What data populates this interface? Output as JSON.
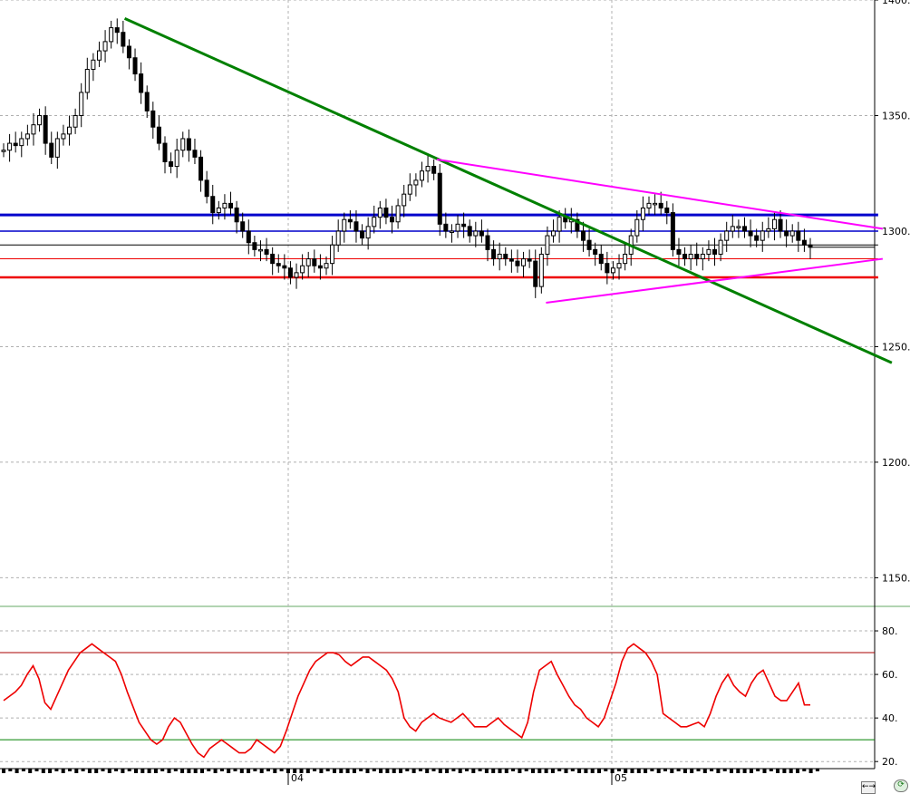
{
  "chart_data": [
    {
      "type": "candlestick",
      "panel": "price",
      "x_labels": [
        "04",
        "05"
      ],
      "y_ticks": [
        1150,
        1200,
        1250,
        1300,
        1350,
        1400
      ],
      "y_tick_labels": [
        "1150.",
        "1200.",
        "1250.",
        "1300.",
        "1350.",
        "1400."
      ],
      "ylim": [
        1138,
        1400
      ],
      "grid": true,
      "grid_style": "dashed",
      "colors": {
        "price": "#000000",
        "trend_down": "#008000",
        "triangle": "#ff00ff",
        "resistance": "#0000cc",
        "support": "#ee0000"
      },
      "close_series": [
        1335,
        1338,
        1337,
        1340,
        1342,
        1346,
        1350,
        1338,
        1332,
        1340,
        1342,
        1345,
        1350,
        1360,
        1370,
        1374,
        1378,
        1382,
        1388,
        1386,
        1380,
        1375,
        1368,
        1360,
        1352,
        1345,
        1338,
        1330,
        1328,
        1335,
        1340,
        1335,
        1332,
        1322,
        1315,
        1308,
        1310,
        1312,
        1310,
        1304,
        1300,
        1295,
        1292,
        1292,
        1290,
        1286,
        1285,
        1284,
        1280,
        1282,
        1285,
        1288,
        1285,
        1284,
        1286,
        1294,
        1300,
        1305,
        1304,
        1300,
        1297,
        1302,
        1306,
        1310,
        1306,
        1304,
        1311,
        1316,
        1320,
        1322,
        1326,
        1328,
        1325,
        1303,
        1300,
        1300,
        1303,
        1302,
        1298,
        1300,
        1298,
        1292,
        1288,
        1290,
        1288,
        1287,
        1285,
        1288,
        1287,
        1276,
        1290,
        1298,
        1300,
        1306,
        1304,
        1305,
        1300,
        1296,
        1292,
        1290,
        1286,
        1282,
        1284,
        1286,
        1290,
        1298,
        1305,
        1310,
        1312,
        1312,
        1310,
        1308,
        1292,
        1290,
        1288,
        1290,
        1288,
        1290,
        1292,
        1290,
        1296,
        1300,
        1302,
        1302,
        1300,
        1298,
        1296,
        1300,
        1301,
        1305,
        1300,
        1298,
        1300,
        1296,
        1294,
        1293
      ],
      "lines": [
        {
          "style": "trend",
          "from": [
            0.137,
            1392
          ],
          "to": [
            0.98,
            1243
          ]
        },
        {
          "style": "triangle_upper",
          "from": [
            0.48,
            1331
          ],
          "to": [
            0.97,
            1301
          ]
        },
        {
          "style": "triangle_lower",
          "from": [
            0.6,
            1269
          ],
          "to": [
            0.97,
            1288
          ]
        },
        {
          "style": "resistance_thick",
          "from": [
            0.0,
            1307
          ],
          "to": [
            0.965,
            1307
          ]
        },
        {
          "style": "resistance_thin",
          "from": [
            0.0,
            1300
          ],
          "to": [
            0.965,
            1300
          ]
        },
        {
          "style": "black_thin",
          "from": [
            0.0,
            1294
          ],
          "to": [
            0.965,
            1294
          ]
        },
        {
          "style": "red_thin",
          "from": [
            0.0,
            1288
          ],
          "to": [
            0.965,
            1288
          ]
        },
        {
          "style": "support_thick",
          "from": [
            0.0,
            1280
          ],
          "to": [
            0.965,
            1280
          ]
        }
      ]
    },
    {
      "type": "line",
      "panel": "oscillator",
      "y_ticks": [
        20,
        40,
        60,
        80
      ],
      "y_tick_labels": [
        "20.",
        "40.",
        "60.",
        "80."
      ],
      "ylim": [
        18,
        90
      ],
      "reference_lines": [
        70,
        30
      ],
      "colors": {
        "line": "#ee0000",
        "upper": "#aa0000",
        "lower": "#008000"
      },
      "values": [
        48,
        50,
        52,
        55,
        60,
        64,
        58,
        47,
        44,
        50,
        56,
        62,
        66,
        70,
        72,
        74,
        72,
        70,
        68,
        66,
        60,
        52,
        45,
        38,
        34,
        30,
        28,
        30,
        36,
        40,
        38,
        33,
        28,
        24,
        22,
        26,
        28,
        30,
        28,
        26,
        24,
        24,
        26,
        30,
        28,
        26,
        24,
        27,
        34,
        42,
        50,
        56,
        62,
        66,
        68,
        70,
        70,
        69,
        66,
        64,
        66,
        68,
        68,
        66,
        64,
        62,
        58,
        52,
        40,
        36,
        34,
        38,
        40,
        42,
        40,
        39,
        38,
        40,
        42,
        39,
        36,
        36,
        36,
        38,
        40,
        37,
        35,
        33,
        31,
        38,
        52,
        62,
        64,
        66,
        60,
        55,
        50,
        46,
        44,
        40,
        38,
        36,
        40,
        48,
        56,
        66,
        72,
        74,
        72,
        70,
        66,
        60,
        42,
        40,
        38,
        36,
        36,
        37,
        38,
        36,
        42,
        50,
        56,
        60,
        55,
        52,
        50,
        56,
        60,
        62,
        56,
        50,
        48,
        48,
        52,
        56,
        46,
        46
      ]
    }
  ],
  "ui": {
    "corner_buttons": [
      "←→",
      "⟳"
    ]
  }
}
